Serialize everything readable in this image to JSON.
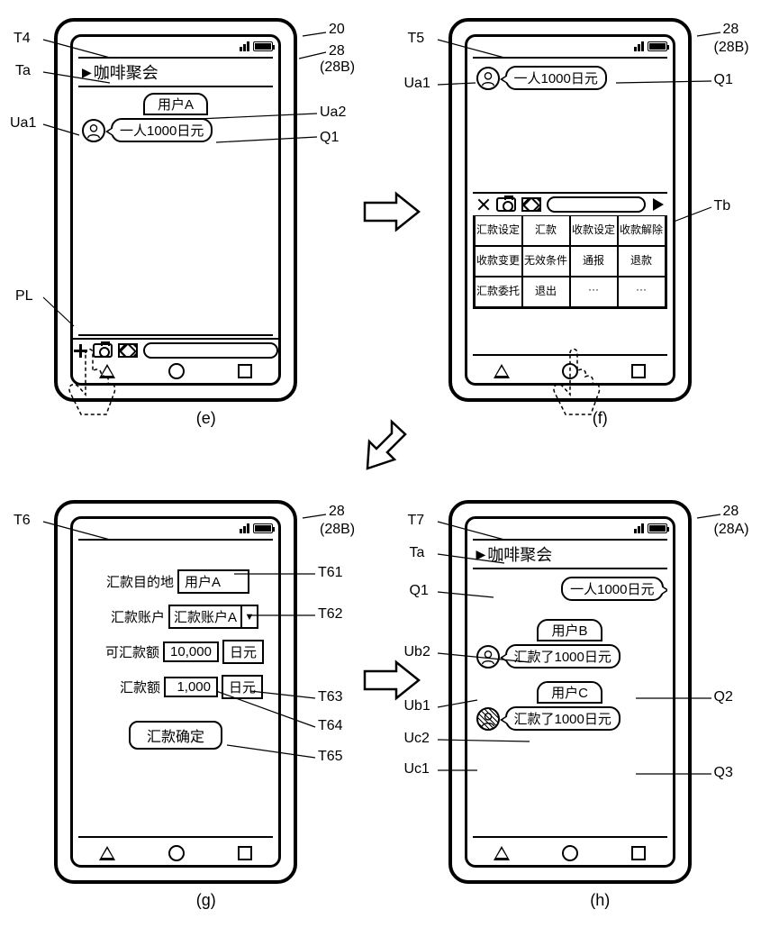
{
  "screens": {
    "e": {
      "caption": "(e)",
      "title": "咖啡聚会",
      "user_label": "用户A",
      "message": "一人1000日元"
    },
    "f": {
      "caption": "(f)",
      "message": "一人1000日元",
      "menu": [
        "汇款设定",
        "汇款",
        "收款设定",
        "收款解除",
        "收款变更",
        "无效条件",
        "通报",
        "退款",
        "汇款委托",
        "退出",
        "···",
        "···"
      ]
    },
    "g": {
      "caption": "(g)",
      "dest_label": "汇款目的地",
      "dest_value": "用户A",
      "acct_label": "汇款账户",
      "acct_value": "汇款账户A",
      "avail_label": "可汇款额",
      "avail_value": "10,000",
      "avail_unit": "日元",
      "amt_label": "汇款额",
      "amt_value": "1,000",
      "amt_unit": "日元",
      "confirm": "汇款确定"
    },
    "h": {
      "caption": "(h)",
      "title": "咖啡聚会",
      "q1": "一人1000日元",
      "userB_label": "用户B",
      "q2": "汇款了1000日元",
      "userC_label": "用户C",
      "q3": "汇款了1000日元"
    }
  },
  "labels": {
    "T4": "T4",
    "Ta": "Ta",
    "Ua1": "Ua1",
    "Ua2": "Ua2",
    "Q1": "Q1",
    "PL": "PL",
    "T5": "T5",
    "Tb": "Tb",
    "T6": "T6",
    "T61": "T61",
    "T62": "T62",
    "T63": "T63",
    "T64": "T64",
    "T65": "T65",
    "T7": "T7",
    "Ub1": "Ub1",
    "Ub2": "Ub2",
    "Uc1": "Uc1",
    "Uc2": "Uc2",
    "Q2": "Q2",
    "Q3": "Q3",
    "r20": "20",
    "r28": "28",
    "r28B": "(28B)",
    "r28A": "(28A)"
  }
}
